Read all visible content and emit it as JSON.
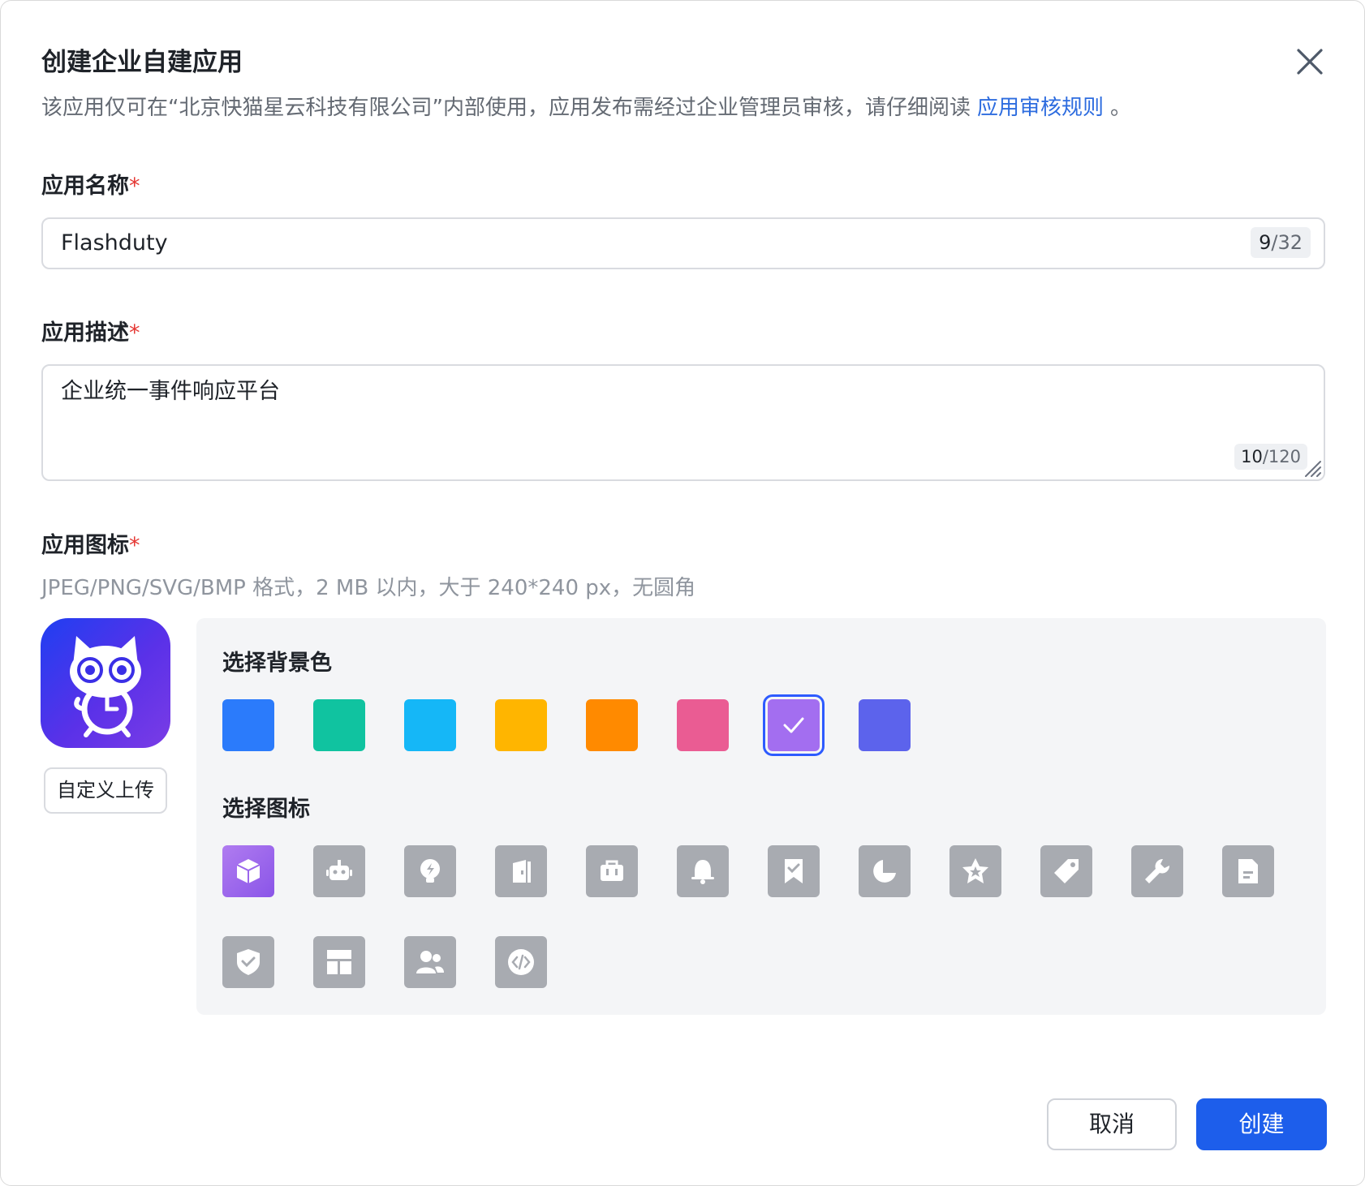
{
  "dialog": {
    "title": "创建企业自建应用",
    "notice_prefix": "该应用仅可在“北京快猫星云科技有限公司”内部使用，应用发布需经过企业管理员审核，请仔细阅读",
    "notice_link": "应用审核规则",
    "notice_suffix": "。"
  },
  "fields": {
    "name": {
      "label": "应用名称",
      "required_mark": "*",
      "value": "Flashduty",
      "count_current": "9",
      "count_max": "/32"
    },
    "description": {
      "label": "应用描述",
      "required_mark": "*",
      "value": "企业统一事件响应平台",
      "count_current": "10",
      "count_max": "/120"
    },
    "icon": {
      "label": "应用图标",
      "required_mark": "*",
      "hint": "JPEG/PNG/SVG/BMP 格式，2 MB 以内，大于 240*240 px，无圆角",
      "upload_label": "自定义上传"
    }
  },
  "picker": {
    "bg_title": "选择背景色",
    "icon_title": "选择图标",
    "colors": [
      {
        "name": "blue",
        "hex": "#2b7bfb",
        "selected": false
      },
      {
        "name": "teal",
        "hex": "#10c3a0",
        "selected": false
      },
      {
        "name": "cyan",
        "hex": "#15b7f7",
        "selected": false
      },
      {
        "name": "amber",
        "hex": "#ffb500",
        "selected": false
      },
      {
        "name": "orange",
        "hex": "#ff8a00",
        "selected": false
      },
      {
        "name": "pink",
        "hex": "#ea5c93",
        "selected": false
      },
      {
        "name": "purple",
        "hex": "#a36ef0",
        "selected": true
      },
      {
        "name": "indigo",
        "hex": "#5c63ec",
        "selected": false
      }
    ],
    "icons": [
      {
        "name": "cube-icon",
        "selected": true
      },
      {
        "name": "robot-icon",
        "selected": false
      },
      {
        "name": "lightbulb-icon",
        "selected": false
      },
      {
        "name": "door-icon",
        "selected": false
      },
      {
        "name": "briefcase-icon",
        "selected": false
      },
      {
        "name": "bell-icon",
        "selected": false
      },
      {
        "name": "bookmark-check-icon",
        "selected": false
      },
      {
        "name": "pie-chart-icon",
        "selected": false
      },
      {
        "name": "star-badge-icon",
        "selected": false
      },
      {
        "name": "tag-icon",
        "selected": false
      },
      {
        "name": "wrench-icon",
        "selected": false
      },
      {
        "name": "document-icon",
        "selected": false
      },
      {
        "name": "shield-check-icon",
        "selected": false
      },
      {
        "name": "layout-icon",
        "selected": false
      },
      {
        "name": "users-icon",
        "selected": false
      },
      {
        "name": "code-icon",
        "selected": false
      }
    ]
  },
  "footer": {
    "cancel_label": "取消",
    "create_label": "创建"
  },
  "colors": {
    "primary": "#1d5eeb",
    "link": "#2d6cdf",
    "required": "#e53935"
  }
}
